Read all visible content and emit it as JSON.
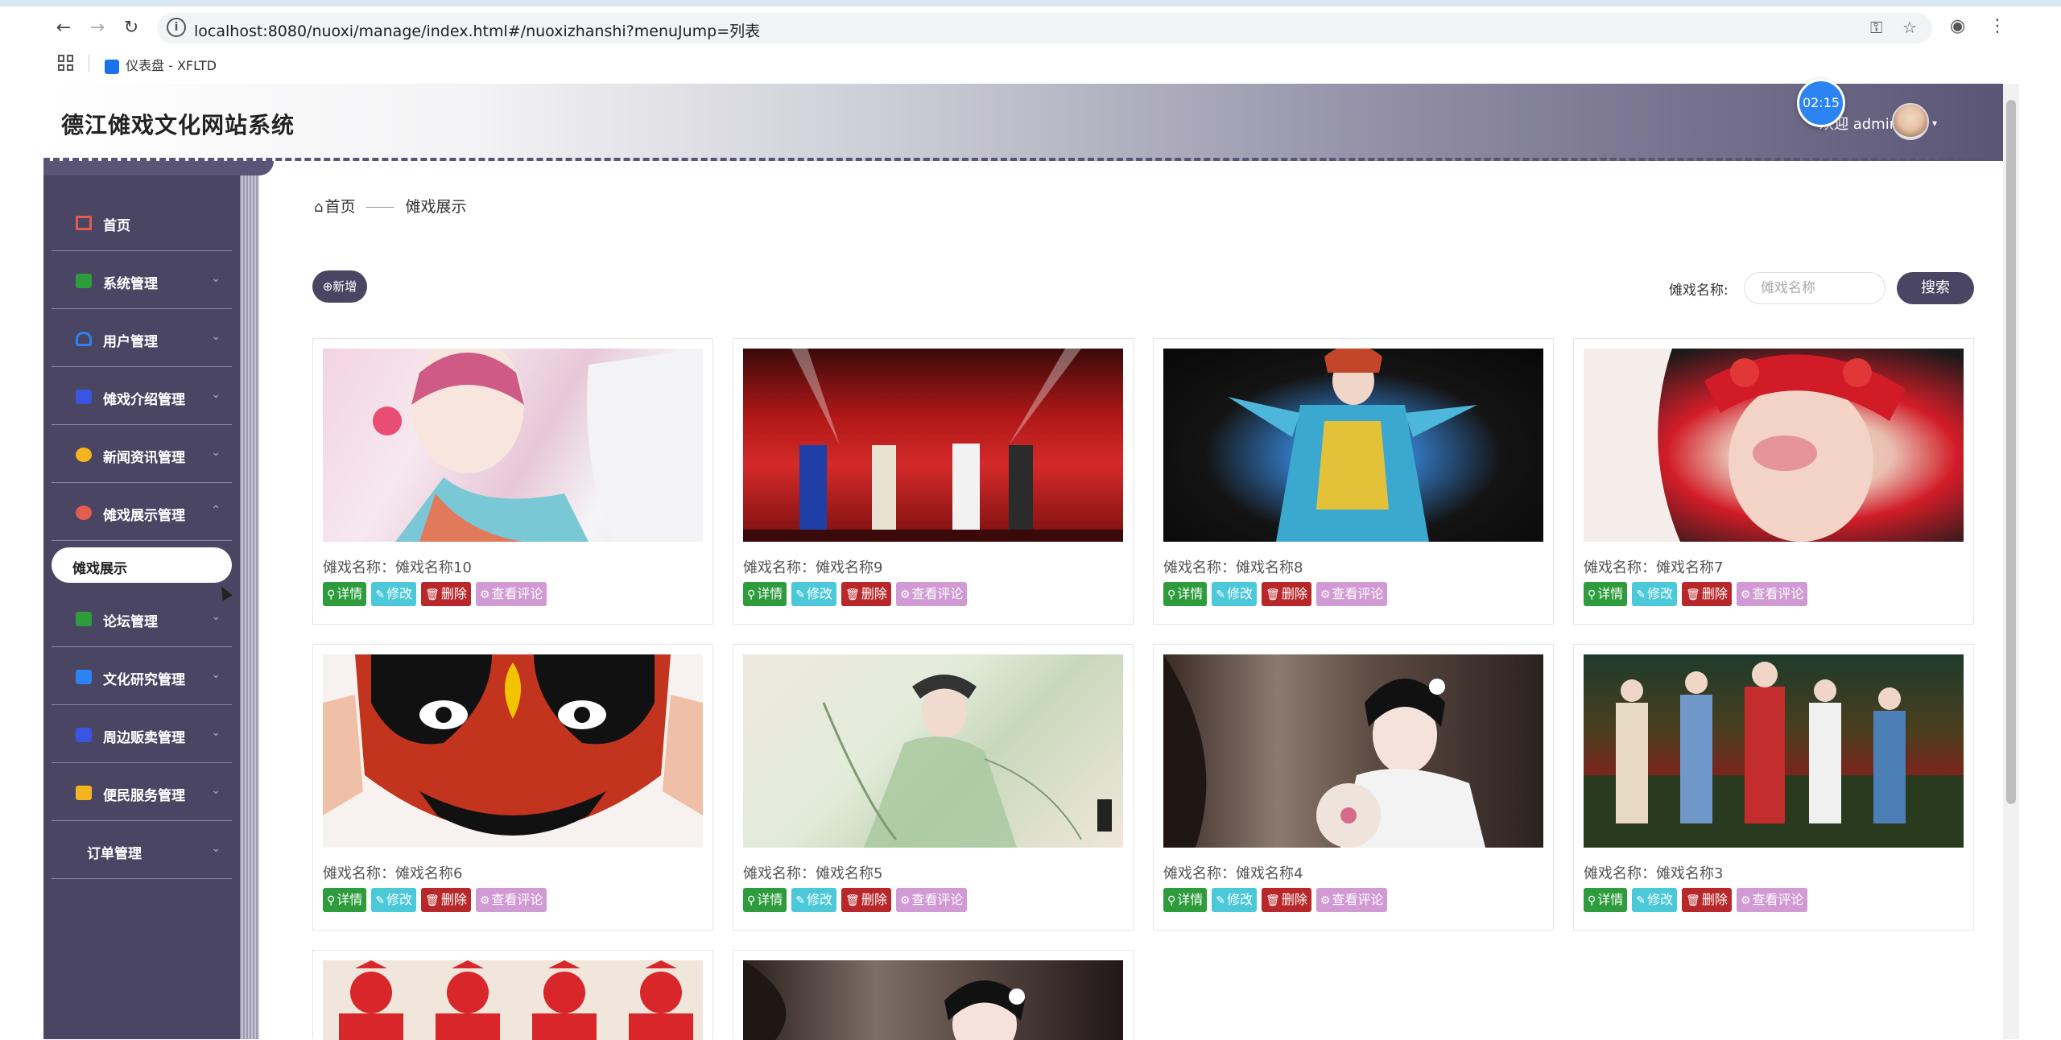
{
  "browser": {
    "url": "localhost:8080/nuoxi/manage/index.html#/nuoxizhanshi?menuJump=列表",
    "bookmark_label": "仪表盘 - XFLTD"
  },
  "header": {
    "title": "德江傩戏文化网站系统",
    "welcome": "欢迎 admin",
    "timer": "02:15"
  },
  "sidebar": {
    "items": [
      {
        "label": "首页",
        "color": "#e35d4e"
      },
      {
        "label": "系统管理",
        "color": "#2e9b3c"
      },
      {
        "label": "用户管理",
        "color": "#2c84f2"
      },
      {
        "label": "傩戏介绍管理",
        "color": "#3a55e0"
      },
      {
        "label": "新闻资讯管理",
        "color": "#f2b51f"
      },
      {
        "label": "傩戏展示管理",
        "color": "#e35d4e"
      },
      {
        "label": "论坛管理",
        "color": "#2e9b3c"
      },
      {
        "label": "文化研究管理",
        "color": "#2c84f2"
      },
      {
        "label": "周边贩卖管理",
        "color": "#3a55e0"
      },
      {
        "label": "便民服务管理",
        "color": "#f2b51f"
      },
      {
        "label": "订单管理",
        "color": ""
      }
    ],
    "submenu_active": "傩戏展示"
  },
  "breadcrumb": {
    "home": "首页",
    "current": "傩戏展示"
  },
  "toolbar": {
    "add_label": "⊕新增",
    "search_label": "傩戏名称:",
    "search_placeholder": "傩戏名称",
    "search_button": "搜索"
  },
  "actions": {
    "detail": "详情",
    "edit": "修改",
    "delete": "删除",
    "comments": "查看评论"
  },
  "cards": [
    {
      "name": "傩戏名称：傩戏名称10"
    },
    {
      "name": "傩戏名称：傩戏名称9"
    },
    {
      "name": "傩戏名称：傩戏名称8"
    },
    {
      "name": "傩戏名称：傩戏名称7"
    },
    {
      "name": "傩戏名称：傩戏名称6"
    },
    {
      "name": "傩戏名称：傩戏名称5"
    },
    {
      "name": "傩戏名称：傩戏名称4"
    },
    {
      "name": "傩戏名称：傩戏名称3"
    },
    {
      "name": ""
    },
    {
      "name": ""
    }
  ]
}
